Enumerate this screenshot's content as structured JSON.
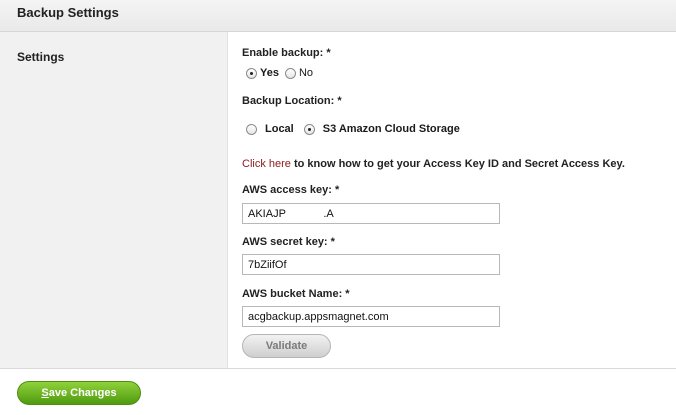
{
  "header": {
    "title": "Backup Settings"
  },
  "sidebar": {
    "label": "Settings"
  },
  "form": {
    "enable_backup": {
      "label": "Enable backup: *",
      "options": [
        "Yes",
        "No"
      ],
      "selected": "Yes"
    },
    "backup_location": {
      "label": "Backup Location: *",
      "options": [
        "Local",
        "S3 Amazon Cloud Storage"
      ],
      "selected": "S3 Amazon Cloud Storage"
    },
    "help": {
      "link_text": "Click here",
      "text": " to know how to get your Access Key ID and Secret Access Key."
    },
    "aws_access_key": {
      "label": "AWS access key: *",
      "value": "AKIAJP                 .A"
    },
    "aws_secret_key": {
      "label": "AWS secret key: *",
      "value": "7bZiifOf"
    },
    "aws_bucket_name": {
      "label": "AWS bucket Name: *",
      "value": "acgbackup.appsmagnet.com"
    },
    "validate_label": "Validate"
  },
  "footer": {
    "save_first": "S",
    "save_rest": "ave Changes"
  },
  "colors": {
    "link": "#8b1a1a",
    "save_green": "#6ab525"
  }
}
